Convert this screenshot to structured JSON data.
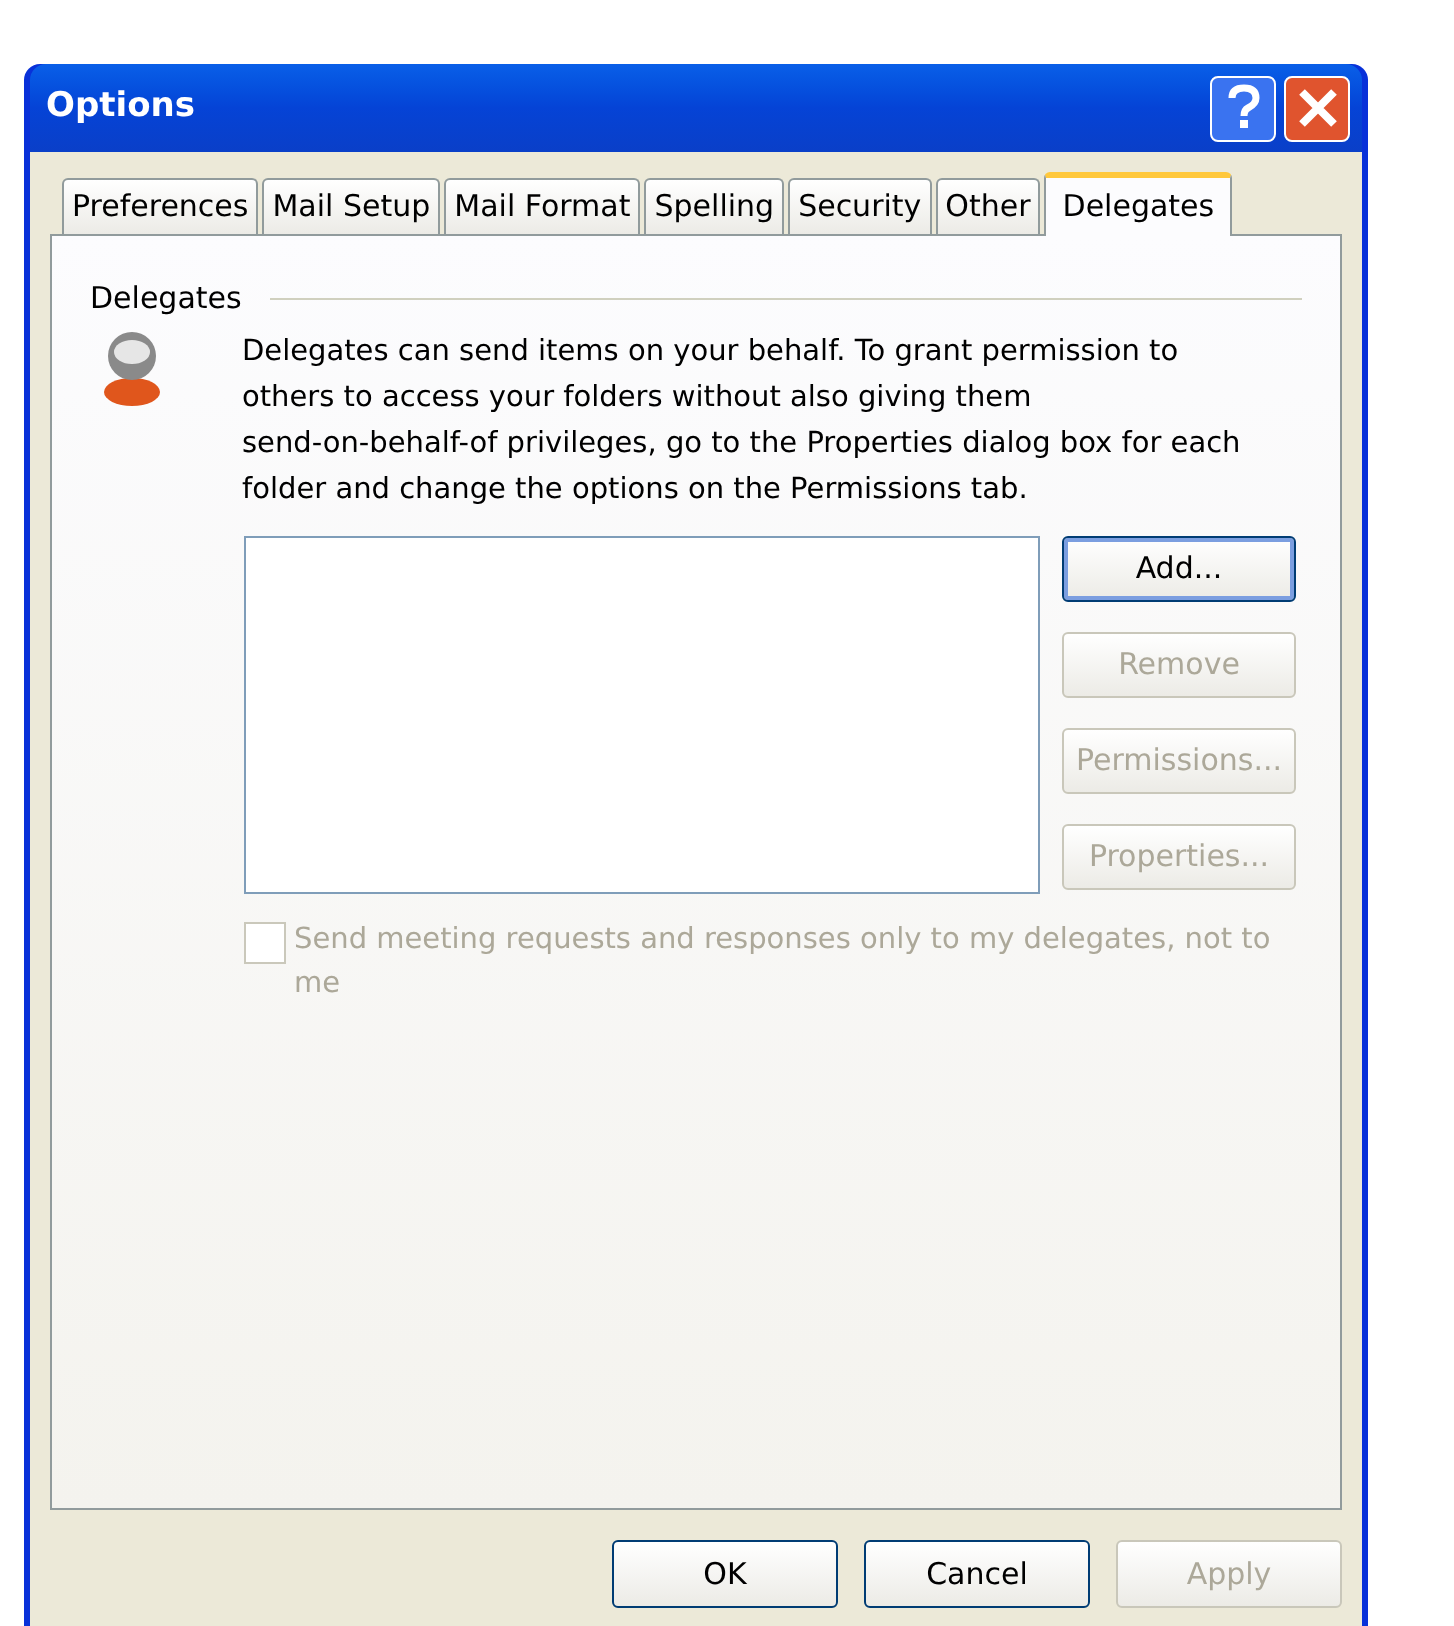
{
  "window": {
    "title": "Options"
  },
  "tabs": [
    {
      "label": "Preferences",
      "selected": false
    },
    {
      "label": "Mail Setup",
      "selected": false
    },
    {
      "label": "Mail Format",
      "selected": false
    },
    {
      "label": "Spelling",
      "selected": false
    },
    {
      "label": "Security",
      "selected": false
    },
    {
      "label": "Other",
      "selected": false
    },
    {
      "label": "Delegates",
      "selected": true
    }
  ],
  "section": {
    "title": "Delegates",
    "description": "Delegates can send items on your behalf. To grant permission to\nothers to access your folders without also giving them\nsend-on-behalf-of privileges, go to the Properties dialog box for each\nfolder and change the options on the Permissions tab."
  },
  "side_buttons": [
    {
      "label": "Add...",
      "disabled": false,
      "default": true
    },
    {
      "label": "Remove",
      "disabled": true,
      "default": false
    },
    {
      "label": "Permissions...",
      "disabled": true,
      "default": false
    },
    {
      "label": "Properties...",
      "disabled": true,
      "default": false
    }
  ],
  "checkbox": {
    "label": "Send meeting requests and responses only to my delegates, not to me",
    "checked": false,
    "disabled": true
  },
  "footer_buttons": [
    {
      "label": "OK",
      "disabled": false
    },
    {
      "label": "Cancel",
      "disabled": false
    },
    {
      "label": "Apply",
      "disabled": true
    }
  ]
}
